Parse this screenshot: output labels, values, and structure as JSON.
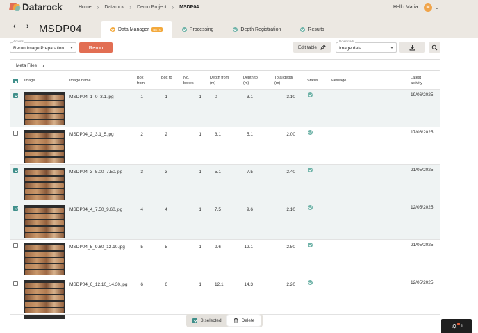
{
  "app": {
    "logo_text": "Datarock",
    "breadcrumbs": [
      "Home",
      "Datarock",
      "Demo Project",
      "MSDP04"
    ],
    "greeting": "Hello Maria",
    "avatar_initial": "M"
  },
  "page": {
    "title": "MSDP04",
    "tabs": [
      {
        "label": "Data Manager",
        "badge": "BETA",
        "active": true
      },
      {
        "label": "Processing",
        "active": false
      },
      {
        "label": "Depth Registration",
        "active": false
      },
      {
        "label": "Results",
        "active": false
      }
    ]
  },
  "toolbar": {
    "actions_label": "Actions",
    "actions_value": "Rerun Image Preparation",
    "rerun_label": "Rerun",
    "edit_table_label": "Edit table",
    "downloads_label": "Downloads",
    "downloads_value": "Image data"
  },
  "meta_files": {
    "label": "Meta Files"
  },
  "table": {
    "headers": {
      "image": "Image",
      "image_name": "Image name",
      "box_from": "Box from",
      "box_to": "Box to",
      "no_boxes": "No. boxes",
      "depth_from": "Depth from (m)",
      "depth_to": "Depth to (m)",
      "total_depth": "Total depth (m)",
      "status": "Status",
      "message": "Message",
      "latest_activity": "Latest activity"
    },
    "rows": [
      {
        "selected": true,
        "name": "MSDP04_1_0_3.1.jpg",
        "box_from": "1",
        "box_to": "1",
        "no_boxes": "1",
        "depth_from": "0",
        "depth_to": "3.1",
        "total_depth": "3.10",
        "message": "",
        "latest": "19/06/2025"
      },
      {
        "selected": false,
        "name": "MSDP04_2_3.1_5.jpg",
        "box_from": "2",
        "box_to": "2",
        "no_boxes": "1",
        "depth_from": "3.1",
        "depth_to": "5.1",
        "total_depth": "2.00",
        "message": "",
        "latest": "17/06/2025"
      },
      {
        "selected": true,
        "name": "MSDP04_3_5.00_7.50.jpg",
        "box_from": "3",
        "box_to": "3",
        "no_boxes": "1",
        "depth_from": "5.1",
        "depth_to": "7.5",
        "total_depth": "2.40",
        "message": "",
        "latest": "21/05/2025"
      },
      {
        "selected": true,
        "name": "MSDP04_4_7.50_9.60.jpg",
        "box_from": "4",
        "box_to": "4",
        "no_boxes": "1",
        "depth_from": "7.5",
        "depth_to": "9.6",
        "total_depth": "2.10",
        "message": "",
        "latest": "12/05/2025"
      },
      {
        "selected": false,
        "name": "MSDP04_5_9.60_12.10.jpg",
        "box_from": "5",
        "box_to": "5",
        "no_boxes": "1",
        "depth_from": "9.6",
        "depth_to": "12.1",
        "total_depth": "2.50",
        "message": "",
        "latest": "21/05/2025"
      },
      {
        "selected": false,
        "name": "MSDP04_6_12.10_14.30.jpg",
        "box_from": "6",
        "box_to": "6",
        "no_boxes": "1",
        "depth_from": "12.1",
        "depth_to": "14.3",
        "total_depth": "2.20",
        "message": "",
        "latest": "12/05/2025"
      }
    ]
  },
  "selection_bar": {
    "selected_text": "3 selected",
    "delete_label": "Delete"
  },
  "notifications": {
    "count": "1"
  },
  "colors": {
    "accent": "#e26e53",
    "teal": "#3f8f8a",
    "status_ok": "#6fb3a8",
    "badge": "#f3a93c",
    "bg": "#f1eee9"
  }
}
